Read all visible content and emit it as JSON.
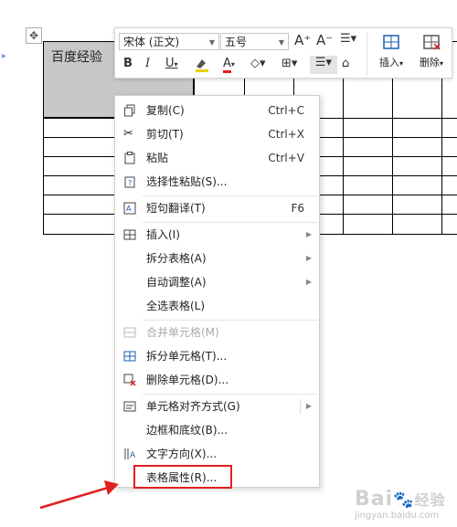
{
  "document": {
    "table_first_cell": "百度经验"
  },
  "toolbar": {
    "font_name": "宋体 (正文)",
    "font_size": "五号",
    "grow_font": "A⁺",
    "shrink_font": "A⁻",
    "bold": "B",
    "italic": "I",
    "underline": "U",
    "font_color_label": "A",
    "insert_label": "插入",
    "delete_label": "删除"
  },
  "context_menu": {
    "items": [
      {
        "label": "复制(C)",
        "shortcut": "Ctrl+C",
        "icon": "copy-icon"
      },
      {
        "label": "剪切(T)",
        "shortcut": "Ctrl+X",
        "icon": "scissors-icon"
      },
      {
        "label": "粘贴",
        "shortcut": "Ctrl+V",
        "icon": "paste-icon"
      },
      {
        "label": "选择性粘贴(S)...",
        "icon": "paste-special-icon"
      },
      {
        "label": "短句翻译(T)",
        "shortcut": "F6",
        "icon": "translate-icon"
      },
      {
        "label": "插入(I)",
        "icon": "table-insert-icon"
      },
      {
        "label": "拆分表格(A)"
      },
      {
        "label": "自动调整(A)"
      },
      {
        "label": "全选表格(L)"
      },
      {
        "label": "合并单元格(M)",
        "icon": "merge-cells-icon"
      },
      {
        "label": "拆分单元格(T)...",
        "icon": "split-cells-icon"
      },
      {
        "label": "删除单元格(D)...",
        "icon": "delete-cells-icon"
      },
      {
        "label": "单元格对齐方式(G)",
        "icon": "cell-align-icon"
      },
      {
        "label": "边框和底纹(B)..."
      },
      {
        "label": "文字方向(X)...",
        "icon": "text-direction-icon"
      },
      {
        "label": "表格属性(R)..."
      }
    ]
  },
  "watermark": {
    "text": "Bai",
    "text_suffix": "经验",
    "sub": "jingyan.baidu.com"
  },
  "colors": {
    "highlight": "#e02020",
    "arrow": "#e02020",
    "selected_cell": "#c8c8c8"
  }
}
